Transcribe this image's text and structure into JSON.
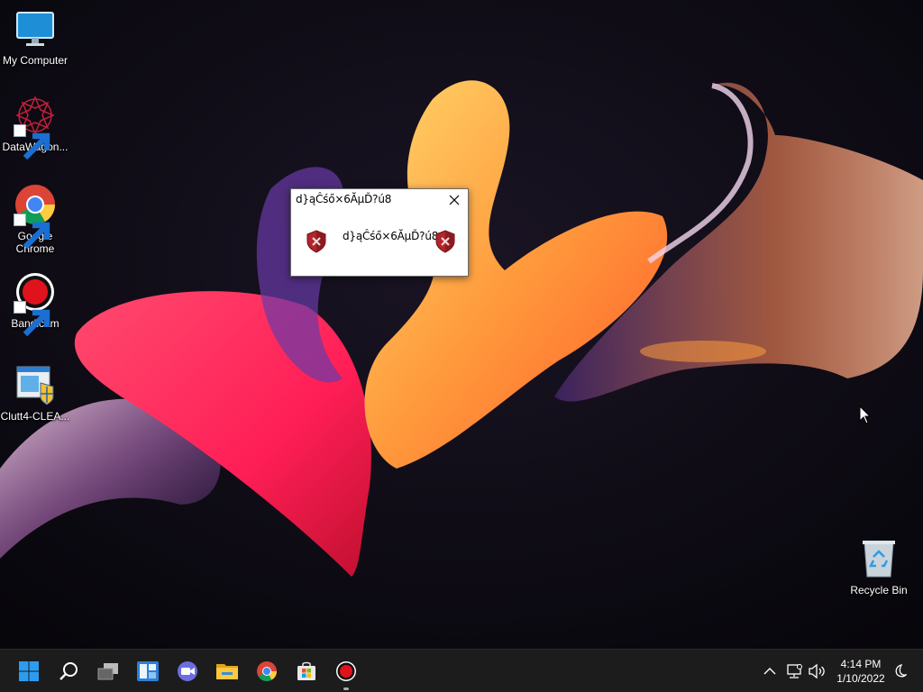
{
  "desktop": {
    "icons": [
      {
        "label": "My Computer",
        "icon": "monitor-icon"
      },
      {
        "label": "DataWagon...",
        "icon": "datawagon-icon"
      },
      {
        "label": "Google Chrome",
        "icon": "chrome-icon"
      },
      {
        "label": "Bandicam",
        "icon": "bandicam-icon"
      },
      {
        "label": "Clutt4-CLEA...",
        "icon": "installer-icon"
      },
      {
        "label": "Recycle Bin",
        "icon": "recycle-bin-icon"
      }
    ]
  },
  "dialog": {
    "title": "d}ąĈśő×6ĂµĎ?ú8",
    "message": "d}ąĈśő×6ĂµĎ?ú8",
    "icon": "shield-error-icon",
    "close_icon": "close-icon"
  },
  "taskbar": {
    "items": [
      {
        "name": "start",
        "icon": "windows-logo-icon"
      },
      {
        "name": "search",
        "icon": "search-icon"
      },
      {
        "name": "task-view",
        "icon": "task-view-icon"
      },
      {
        "name": "widgets",
        "icon": "widgets-icon"
      },
      {
        "name": "chat",
        "icon": "chat-icon"
      },
      {
        "name": "file-explorer",
        "icon": "folder-icon"
      },
      {
        "name": "chrome",
        "icon": "chrome-icon"
      },
      {
        "name": "store",
        "icon": "store-icon"
      },
      {
        "name": "bandicam",
        "icon": "bandicam-icon"
      }
    ],
    "tray": {
      "chevron": "chevron-up-icon",
      "network": "network-icon",
      "volume": "volume-icon",
      "time": "4:14 PM",
      "date": "1/10/2022",
      "focus": "moon-icon"
    }
  },
  "colors": {
    "taskbar_bg": "#1c1c1c",
    "windows_blue": "#2c9cf0",
    "bandicam_red": "#e0131c",
    "shield_red": "#b3242b"
  }
}
